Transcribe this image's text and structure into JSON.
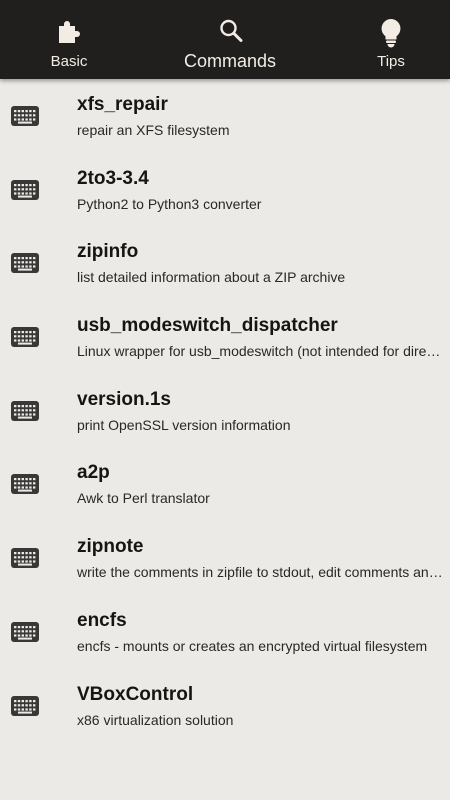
{
  "tabs": [
    {
      "label": "Basic",
      "icon": "puzzle-icon"
    },
    {
      "label": "Commands",
      "icon": "search-icon"
    },
    {
      "label": "Tips",
      "icon": "lightbulb-icon"
    }
  ],
  "commands": [
    {
      "name": "xfs_repair",
      "desc": "repair an XFS filesystem"
    },
    {
      "name": "2to3-3.4",
      "desc": "Python2 to Python3 converter"
    },
    {
      "name": "zipinfo",
      "desc": "list detailed information about a ZIP archive"
    },
    {
      "name": "usb_modeswitch_dispatcher",
      "desc": "Linux wrapper for usb_modeswitch (not intended for direct use)"
    },
    {
      "name": "version.1s",
      "desc": "print OpenSSL version information"
    },
    {
      "name": "a2p",
      "desc": "Awk to Perl translator"
    },
    {
      "name": "zipnote",
      "desc": "write the comments in zipfile to stdout, edit comments and rename files"
    },
    {
      "name": "encfs",
      "desc": "encfs - mounts or creates an encrypted virtual filesystem"
    },
    {
      "name": "VBoxControl",
      "desc": "x86 virtualization solution"
    }
  ],
  "colors": {
    "topbar": "#211F1E",
    "background": "#ECEAE6",
    "tab_text": "#F2ECE4"
  }
}
